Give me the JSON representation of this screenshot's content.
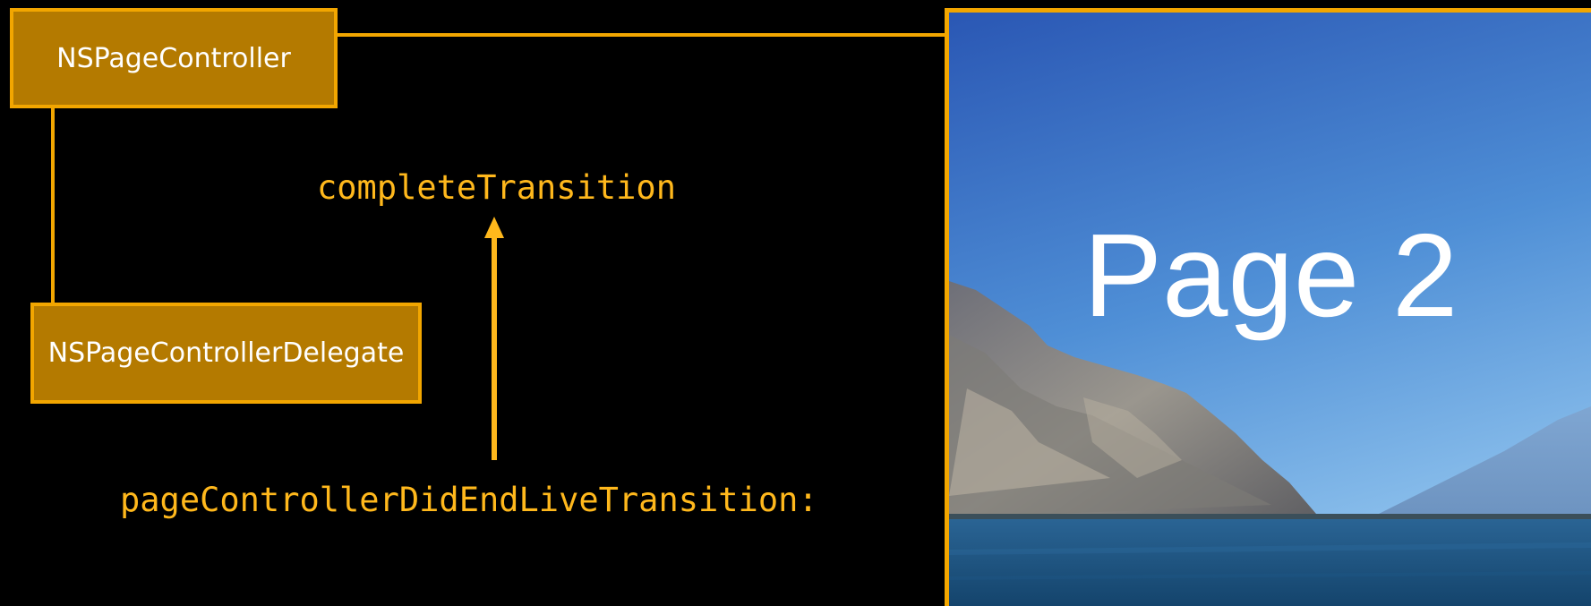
{
  "diagram": {
    "page_controller_label": "NSPageController",
    "delegate_label": "NSPageControllerDelegate",
    "complete_transition_label": "completeTransition",
    "did_end_label": "pageControllerDidEndLiveTransition:",
    "page_title": "Page 2"
  },
  "colors": {
    "background": "#000000",
    "box_fill": "#b47a00",
    "box_border": "#f2a600",
    "code_text": "#ffb81c",
    "sky_top": "#2b5cb8",
    "sky_bottom": "#7fb6e8",
    "water": "#1c4f7c"
  },
  "icons": {
    "arrow": "up-arrow",
    "page_image": "lake-mountain-photo"
  }
}
